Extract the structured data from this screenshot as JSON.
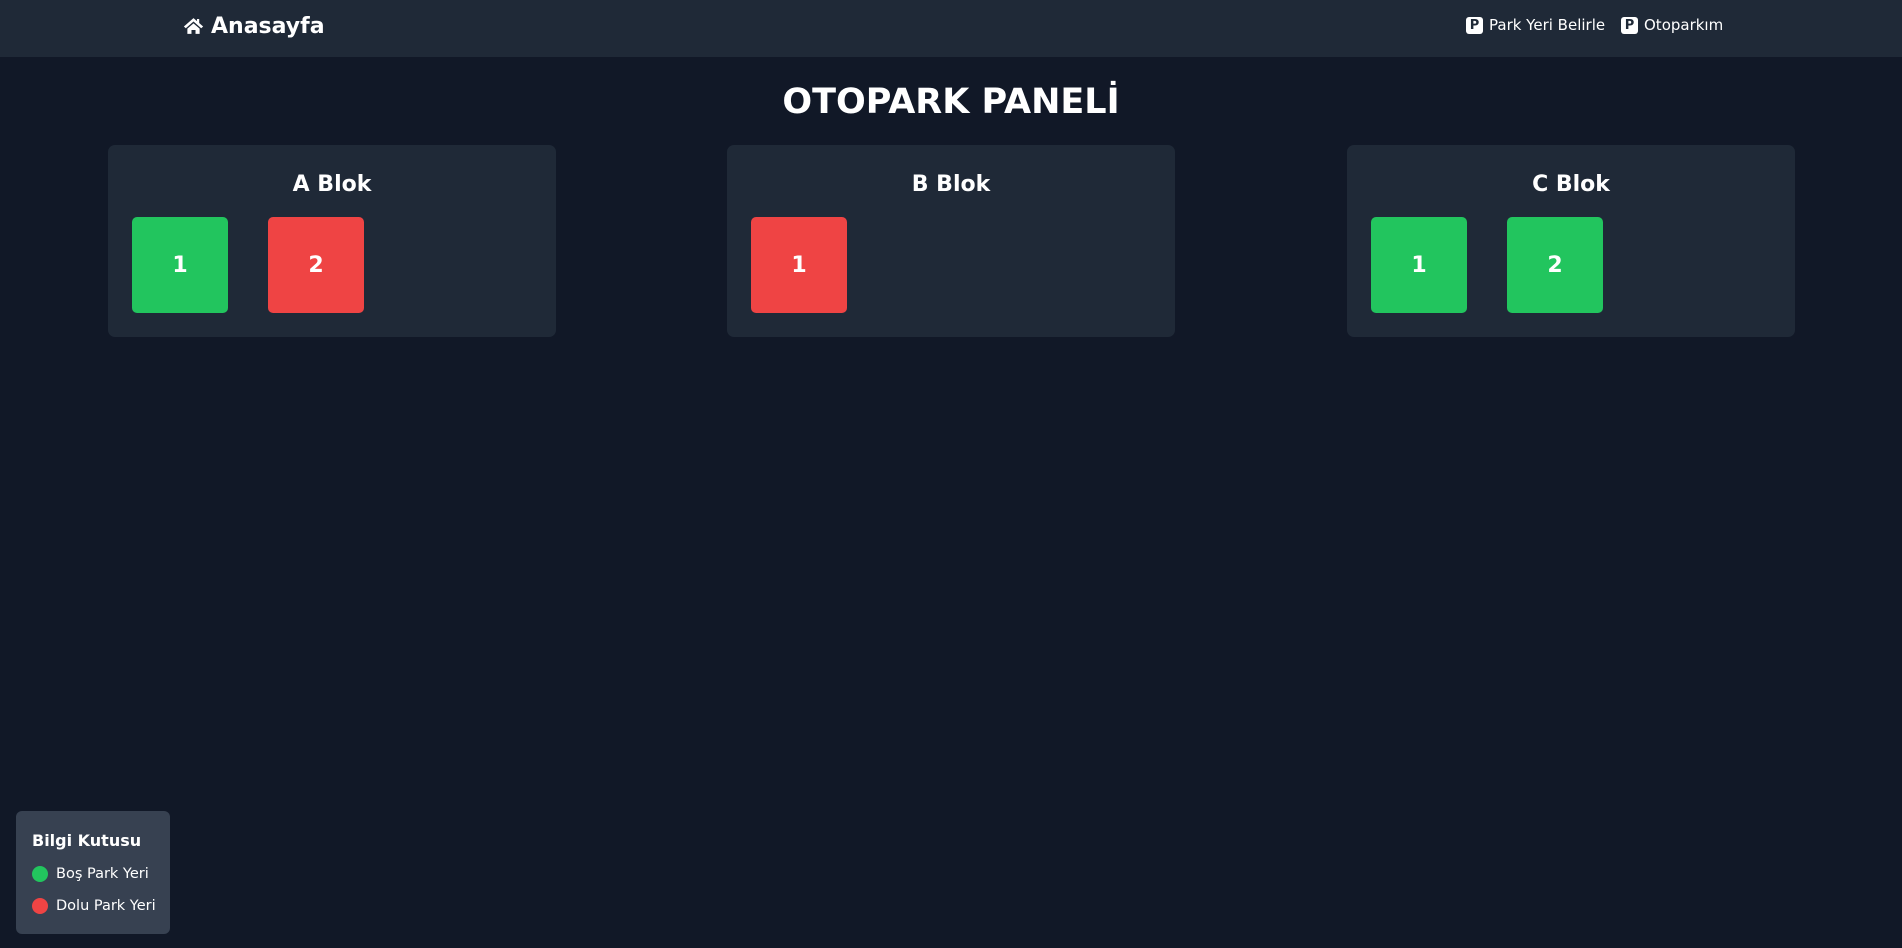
{
  "navbar": {
    "brand": {
      "label": "Anasayfa",
      "icon": "home-icon"
    },
    "links": [
      {
        "label": "Park Yeri Belirle",
        "icon": "parking-icon",
        "icon_glyph": "P"
      },
      {
        "label": "Otoparkım",
        "icon": "parking-icon",
        "icon_glyph": "P"
      }
    ]
  },
  "page": {
    "title": "OTOPARK PANELİ"
  },
  "colors": {
    "empty": "#22c55e",
    "occupied": "#ef4444",
    "background": "#111827",
    "panel": "#1f2937",
    "legend_bg": "#374151"
  },
  "blocks": [
    {
      "name": "A Blok",
      "spots": [
        {
          "number": "1",
          "status": "empty"
        },
        {
          "number": "2",
          "status": "occupied"
        }
      ]
    },
    {
      "name": "B Blok",
      "spots": [
        {
          "number": "1",
          "status": "occupied"
        }
      ]
    },
    {
      "name": "C Blok",
      "spots": [
        {
          "number": "1",
          "status": "empty"
        },
        {
          "number": "2",
          "status": "empty"
        }
      ]
    }
  ],
  "legend": {
    "title": "Bilgi Kutusu",
    "items": [
      {
        "label": "Boş Park Yeri",
        "status": "empty"
      },
      {
        "label": "Dolu Park Yeri",
        "status": "occupied"
      }
    ]
  }
}
